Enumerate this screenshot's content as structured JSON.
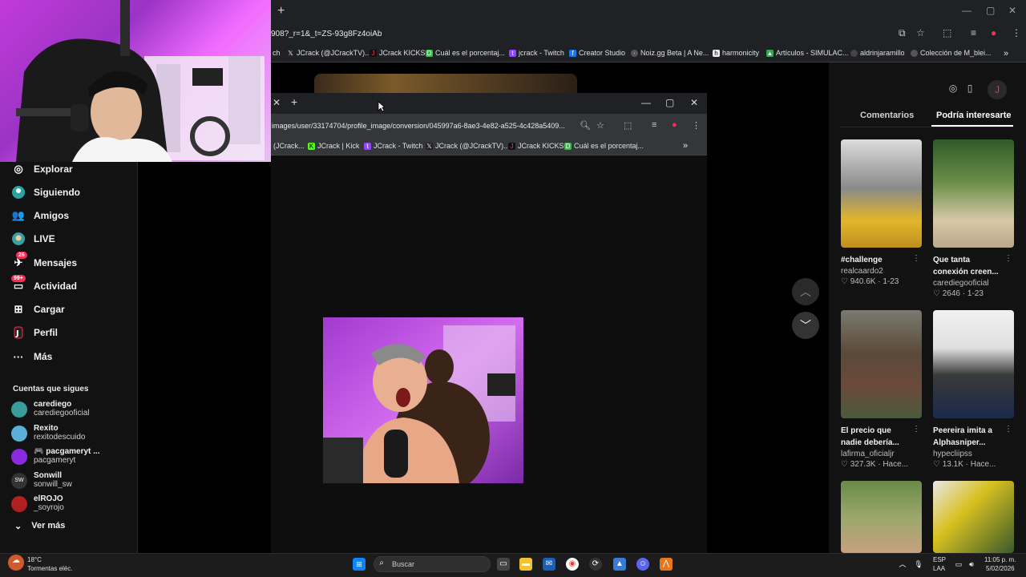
{
  "background_browser": {
    "url": "908?_r=1&_t=ZS-93g8Fz4oiAb",
    "bookmarks": [
      "ch",
      "JCrack (@JCrackTV)...",
      "JCrack KICKS",
      "Cuál es el porcentaj...",
      "jcrack - Twitch",
      "Creator Studio",
      "Noiz.gg Beta | A Ne...",
      "harmonicity",
      "Artículos - SIMULAC...",
      "aldrinjaramillo",
      "Colección de M_blei..."
    ]
  },
  "popup_browser": {
    "url": "images/user/33174704/profile_image/conversion/045997a6-8ae3-4e82-a525-4c428a5409...",
    "bookmarks": [
      "(JCrack...",
      "JCrack | Kick",
      "JCrack - Twitch",
      "JCrack (@JCrackTV)...",
      "JCrack KICKS",
      "Cuál es el porcentaj..."
    ]
  },
  "left_nav": {
    "items": [
      {
        "label": "Explorar",
        "icon": "compass-icon"
      },
      {
        "label": "Siguiendo",
        "icon": "following-icon"
      },
      {
        "label": "Amigos",
        "icon": "friends-icon"
      },
      {
        "label": "LIVE",
        "icon": "live-icon"
      },
      {
        "label": "Mensajes",
        "icon": "messages-icon",
        "badge": "26"
      },
      {
        "label": "Actividad",
        "icon": "activity-icon",
        "badge": "99+"
      },
      {
        "label": "Cargar",
        "icon": "upload-icon"
      },
      {
        "label": "Perfil",
        "icon": "profile-icon"
      },
      {
        "label": "Más",
        "icon": "more-icon"
      }
    ],
    "following_title": "Cuentas que sigues",
    "accounts": [
      {
        "name": "carediego",
        "handle": "carediegooficial"
      },
      {
        "name": "Rexito",
        "handle": "rexitodescuido"
      },
      {
        "name": "🎮 pacgameryt ...",
        "handle": "pacgameryt"
      },
      {
        "name": "Sonwill",
        "handle": "sonwill_sw"
      },
      {
        "name": "elROJO",
        "handle": "_soyrojo"
      }
    ],
    "see_more": "Ver más"
  },
  "right_panel": {
    "tab_comments": "Comentarios",
    "tab_suggested": "Podría interesarte",
    "cards": [
      {
        "title": "#challenge",
        "user": "realcaardo2",
        "stats": "♡ 940.6K · 1-23"
      },
      {
        "title": "Que tanta conexión creen...",
        "user": "carediegooficial",
        "stats": "♡ 2646 · 1-23"
      },
      {
        "title": "El precio que nadie debería...",
        "user": "lafirma_oficialjr",
        "stats": "♡ 327.3K · Hace..."
      },
      {
        "title": "Peereira imita a Alphasniper...",
        "user": "hypecliipss",
        "stats": "♡ 13.1K · Hace..."
      },
      {
        "title": "",
        "user": "",
        "stats": ""
      },
      {
        "title": "",
        "user": "",
        "stats": ""
      }
    ]
  },
  "taskbar": {
    "weather_temp": "18°C",
    "weather_desc": "Tormentas eléc.",
    "search_placeholder": "Buscar",
    "lang_1": "ESP",
    "lang_2": "LAA",
    "time": "11:05 p. m.",
    "date": "5/02/2026"
  },
  "colors": {
    "accent": "#fe2c55",
    "panel": "#121212",
    "chrome": "#202124"
  }
}
